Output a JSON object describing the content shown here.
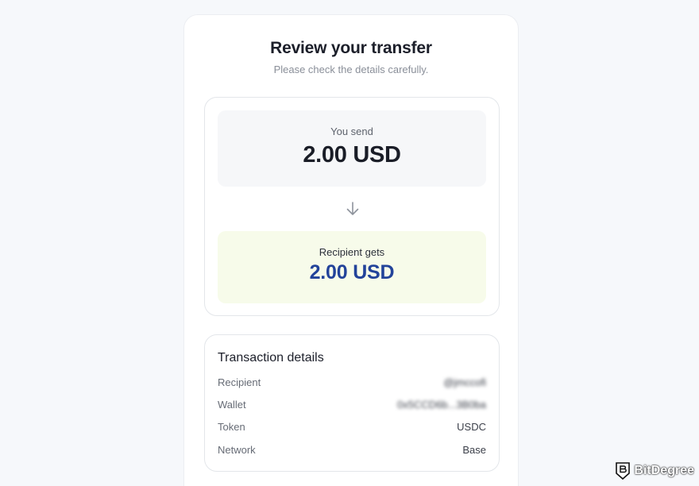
{
  "page": {
    "title": "Review your transfer",
    "subtitle": "Please check the details carefully."
  },
  "amounts": {
    "send_label": "You send",
    "send_amount": "2.00 USD",
    "arrow_icon": "arrow-down-icon",
    "receive_label": "Recipient gets",
    "receive_amount": "2.00 USD"
  },
  "details": {
    "title": "Transaction details",
    "rows": [
      {
        "label": "Recipient",
        "value": "@jmccofi"
      },
      {
        "label": "Wallet",
        "value": "0x5CCD6b...3B0ba"
      },
      {
        "label": "Token",
        "value": "USDC"
      },
      {
        "label": "Network",
        "value": "Base"
      }
    ]
  },
  "watermark": {
    "text": "BitDegree",
    "icon": "bitdegree-shield-logo"
  },
  "colors": {
    "background": "#f6f8fb",
    "receive_box": "#f7fbea",
    "receive_amount": "#23439a"
  }
}
